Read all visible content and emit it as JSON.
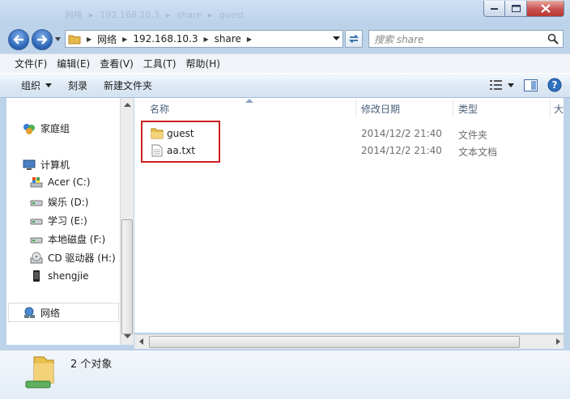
{
  "ghost_path": [
    "网络",
    "192.168.10.3",
    "share",
    "guest"
  ],
  "address": {
    "segments": [
      "网络",
      "192.168.10.3",
      "share"
    ]
  },
  "search": {
    "placeholder": "搜索 share"
  },
  "menu": [
    "文件(F)",
    "编辑(E)",
    "查看(V)",
    "工具(T)",
    "帮助(H)"
  ],
  "toolbar": {
    "organize": "组织",
    "burn": "刻录",
    "new_folder": "新建文件夹"
  },
  "nav": {
    "homegroup": "家庭组",
    "computer": "计算机",
    "drives": [
      "Acer (C:)",
      "娱乐 (D:)",
      "学习 (E:)",
      "本地磁盘 (F:)",
      "CD 驱动器 (H:)",
      "shengjie"
    ],
    "network": "网络"
  },
  "columns": [
    "名称",
    "修改日期",
    "类型",
    "大"
  ],
  "files": [
    {
      "name": "guest",
      "date": "2014/12/2 21:40",
      "type": "文件夹"
    },
    {
      "name": "aa.txt",
      "date": "2014/12/2 21:40",
      "type": "文本文档"
    }
  ],
  "status": {
    "count": "2 个对象"
  },
  "colors": {
    "highlight": "#cc1f1f",
    "titlebar": "#bcd3ea",
    "accent": "#2f66b8"
  }
}
